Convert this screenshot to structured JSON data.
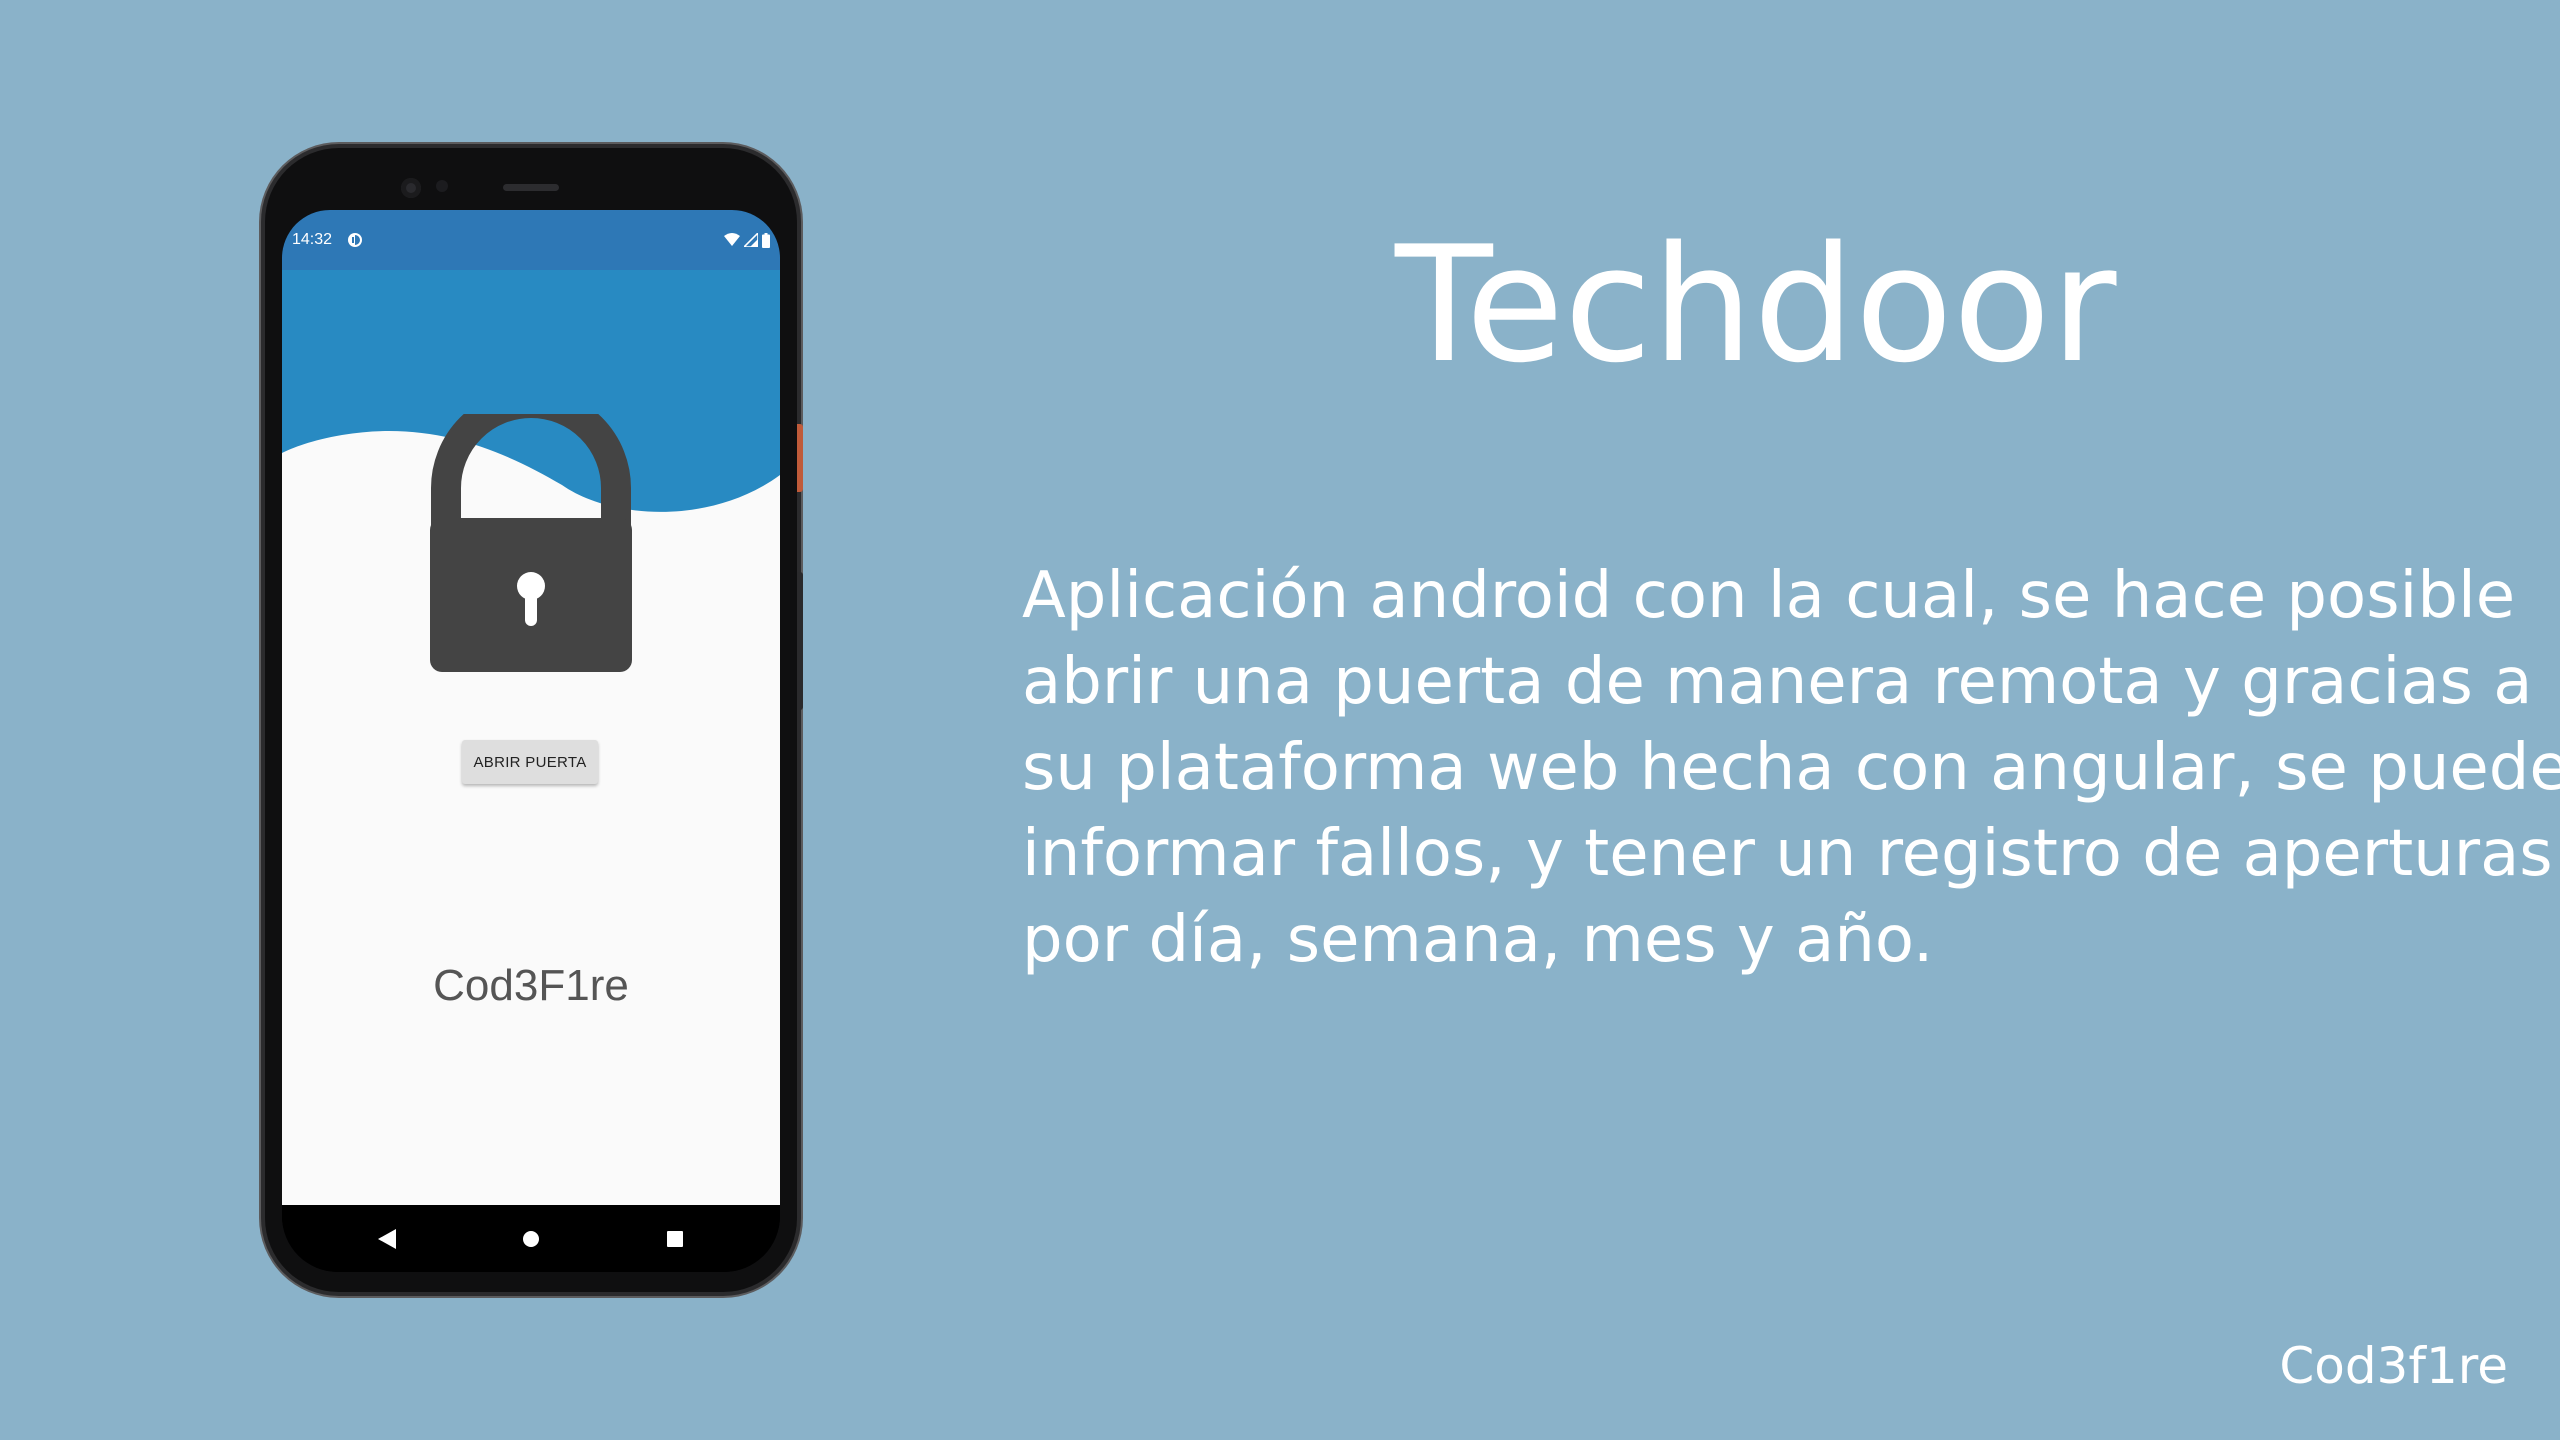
{
  "colors": {
    "background": "#8ab2c9",
    "status_bar": "#2e78b6",
    "wave": "#288ac2",
    "lock": "#444444",
    "text": "#ffffff"
  },
  "phone": {
    "status_bar": {
      "time": "14:32",
      "icons": [
        "app-notification-icon",
        "wifi-icon",
        "signal-icon",
        "battery-icon"
      ]
    },
    "app": {
      "lock_icon": "padlock-icon",
      "button_label": "ABRIR PUERTA",
      "brand": "Cod3F1re"
    },
    "nav_bar": {
      "icons": [
        "back-icon",
        "home-icon",
        "recents-icon"
      ]
    }
  },
  "slide": {
    "title": "Techdoor",
    "description_lines": [
      "Aplicación android con la cual, se hace posible",
      "abrir una puerta de manera remota y gracias a",
      "su plataforma web hecha con angular, se pueden",
      "informar fallos, y tener un registro de aperturas",
      "por día, semana, mes y año."
    ],
    "signature": "Cod3f1re"
  }
}
